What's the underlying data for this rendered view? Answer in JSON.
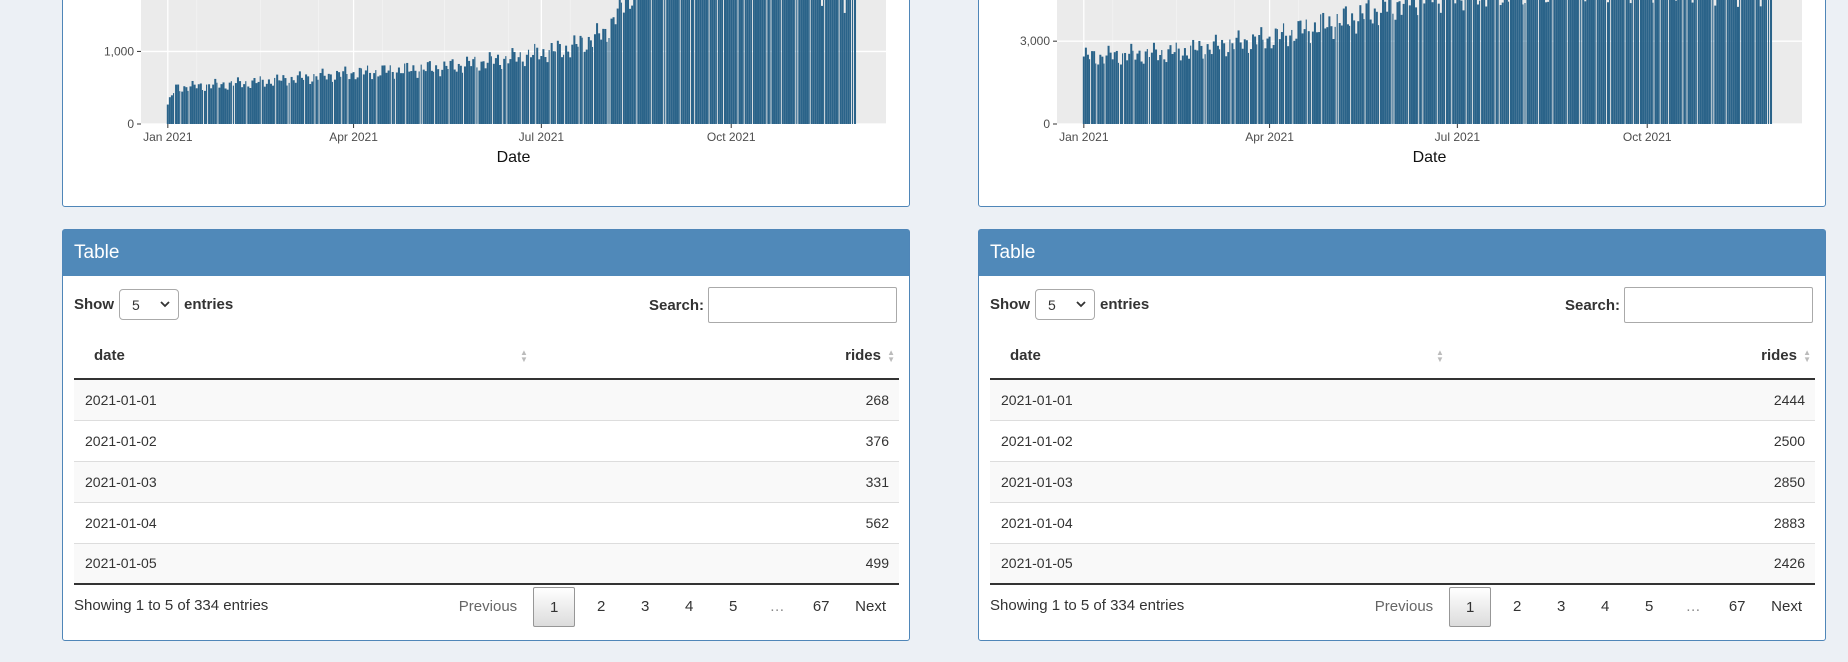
{
  "colors": {
    "header": "#5089b9",
    "bar": "#2a6389",
    "panel_bg": "#ebebeb"
  },
  "chart_data": [
    {
      "type": "bar",
      "xlabel": "Date",
      "ylabel": "",
      "ylim": [
        0,
        1750
      ],
      "y_ticks": [
        "0",
        "1,000"
      ],
      "y_tick_values": [
        0,
        1000
      ],
      "x_ticks": [
        "Jan 2021",
        "Apr 2021",
        "Jul 2021",
        "Oct 2021"
      ],
      "x_tick_dates": [
        "2021-01-01",
        "2021-04-01",
        "2021-07-01",
        "2021-10-01"
      ],
      "x_range": [
        "2020-12-19",
        "2021-12-15"
      ],
      "grid": true,
      "series_start": "2021-01-01",
      "series_end": "2021-11-30",
      "trend": [
        {
          "date": "2021-01-01",
          "value": 268
        },
        {
          "date": "2021-01-05",
          "value": 499
        },
        {
          "date": "2021-02-15",
          "value": 580
        },
        {
          "date": "2021-04-01",
          "value": 700
        },
        {
          "date": "2021-05-15",
          "value": 780
        },
        {
          "date": "2021-06-15",
          "value": 900
        },
        {
          "date": "2021-07-15",
          "value": 1050
        },
        {
          "date": "2021-08-01",
          "value": 1250
        },
        {
          "date": "2021-08-15",
          "value": 1900
        },
        {
          "date": "2021-10-15",
          "value": 2300
        },
        {
          "date": "2021-11-25",
          "value": 1800
        }
      ]
    },
    {
      "type": "bar",
      "xlabel": "Date",
      "ylabel": "",
      "ylim": [
        0,
        4600
      ],
      "y_ticks": [
        "0",
        "3,000"
      ],
      "y_tick_values": [
        0,
        3000
      ],
      "x_ticks": [
        "Jan 2021",
        "Apr 2021",
        "Jul 2021",
        "Oct 2021"
      ],
      "x_tick_dates": [
        "2021-01-01",
        "2021-04-01",
        "2021-07-01",
        "2021-10-01"
      ],
      "x_range": [
        "2020-12-19",
        "2021-12-15"
      ],
      "grid": true,
      "series_start": "2021-01-01",
      "series_end": "2021-11-30",
      "trend": [
        {
          "date": "2021-01-01",
          "value": 2444
        },
        {
          "date": "2021-01-05",
          "value": 2426
        },
        {
          "date": "2021-02-15",
          "value": 2600
        },
        {
          "date": "2021-04-01",
          "value": 3100
        },
        {
          "date": "2021-05-15",
          "value": 3900
        },
        {
          "date": "2021-06-15",
          "value": 4700
        },
        {
          "date": "2021-09-15",
          "value": 5200
        },
        {
          "date": "2021-11-30",
          "value": 5000
        }
      ]
    }
  ],
  "panels": [
    {
      "title": "Table",
      "show_label": "Show",
      "entries_label": "entries",
      "page_size": "5",
      "search_label": "Search:",
      "search_value": "",
      "columns": [
        "date",
        "rides"
      ],
      "rows": [
        [
          "2021-01-01",
          "268"
        ],
        [
          "2021-01-02",
          "376"
        ],
        [
          "2021-01-03",
          "331"
        ],
        [
          "2021-01-04",
          "562"
        ],
        [
          "2021-01-05",
          "499"
        ]
      ],
      "info": "Showing 1 to 5 of 334 entries",
      "pagination": {
        "previous": "Previous",
        "pages": [
          "1",
          "2",
          "3",
          "4",
          "5",
          "…",
          "67"
        ],
        "next": "Next",
        "current": "1"
      }
    },
    {
      "title": "Table",
      "show_label": "Show",
      "entries_label": "entries",
      "page_size": "5",
      "search_label": "Search:",
      "search_value": "",
      "columns": [
        "date",
        "rides"
      ],
      "rows": [
        [
          "2021-01-01",
          "2444"
        ],
        [
          "2021-01-02",
          "2500"
        ],
        [
          "2021-01-03",
          "2850"
        ],
        [
          "2021-01-04",
          "2883"
        ],
        [
          "2021-01-05",
          "2426"
        ]
      ],
      "info": "Showing 1 to 5 of 334 entries",
      "pagination": {
        "previous": "Previous",
        "pages": [
          "1",
          "2",
          "3",
          "4",
          "5",
          "…",
          "67"
        ],
        "next": "Next",
        "current": "1"
      }
    }
  ]
}
